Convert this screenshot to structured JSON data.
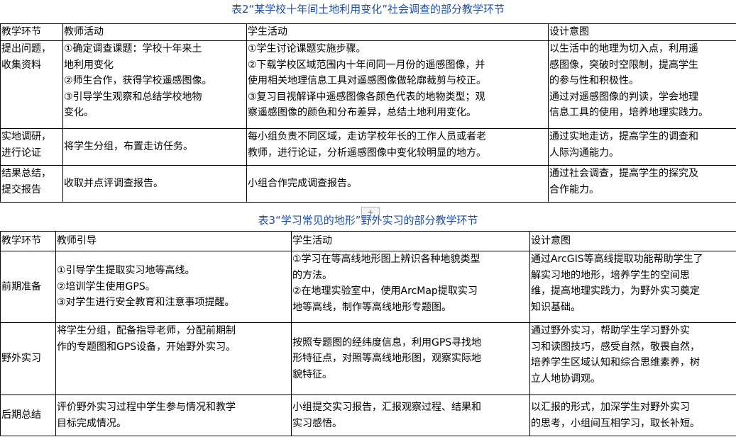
{
  "table2": {
    "caption": "表2“某学校十年间土地利用变化”社会调查的部分教学环节",
    "headers": [
      "教学环节",
      "教师活动",
      "学生活动",
      "设计意图"
    ],
    "rows": [
      [
        [
          "提出问题，",
          "收集资料"
        ],
        [
          "①确定调查课题：学校十年来土",
          "地利用变化",
          "②师生合作，获得学校遥感图像。",
          "③引导学生观察和总结学校地物",
          "变化。"
        ],
        [
          "①学生讨论课题实施步骤。",
          "②下载学校区域范围内十年间同一月份的遥感图像，并",
          "使用相关地理信息工具对遥感图像做轮廓裁剪与校正。",
          "③复习目视解译中遥感图像各颜色代表的地物类型；观",
          "察遥感图像的颜色和分布差异，总结土地利用变化。"
        ],
        [
          "以生活中的地理为切入点，利用遥",
          "感图像，突破时空限制，提高学生",
          "的参与性和积极性。",
          "通过对遥感图像的判读，学会地理",
          "信息工具的使用，培养地理实践力。"
        ]
      ],
      [
        [
          "实地调研，",
          "进行论证"
        ],
        [
          "将学生分组，布置走访任务。"
        ],
        [
          "每小组负责不同区域，走访学校年长的工作人员或者老",
          "教师，进行论证，分析遥感图像中变化较明显的地方。"
        ],
        [
          "通过实地走访，提高学生的调查和",
          "人际沟通能力。"
        ]
      ],
      [
        [
          "结果总结，",
          "提交报告"
        ],
        [
          "收取并点评调查报告。"
        ],
        [
          "小组合作完成调查报告。"
        ],
        [
          "通过社会调查，提高学生的探究及",
          "合作能力。"
        ]
      ]
    ]
  },
  "table3": {
    "caption": "表3“学习常见的地形”野外实习的部分教学环节",
    "headers": [
      "教学环节",
      "教师引导",
      "学生活动",
      "设计意图"
    ],
    "rows": [
      [
        [
          "前期准备"
        ],
        [
          "①引导学生提取实习地等高线。",
          "②培训学生使用GPS。",
          "③对学生进行安全教育和注意事项提醒。"
        ],
        [
          "①学习在等高线地形图上辨识各种地貌类型",
          "的方法。",
          "②在地理实验室中，使用ArcMap提取实习",
          "地等高线，制作等高线地形专题图。"
        ],
        [
          "通过ArcGIS等高线提取功能帮助学生了",
          "解实习地的地形，培养学生的空间思",
          "维，提高地理实践力，为野外实习奠定",
          "知识基础。"
        ]
      ],
      [
        [
          "野外实习"
        ],
        [
          "将学生分组，配备指导老师，分配前期制",
          "作的专题图和GPS设备，开始野外实习。"
        ],
        [
          "按照专题图的经纬度信息，利用GPS寻找地",
          "形特征点，对照等高线地形图，观察实际地",
          "貌特征。"
        ],
        [
          "通过野外实习，帮助学生学习野外实",
          "习和读图技巧，感受自然，敬畏自然，",
          "培养学生区域认知和综合思维素养，树",
          "立人地协调观。"
        ]
      ],
      [
        [
          "后期总结"
        ],
        [
          "评价野外实习过程中学生参与情况和教学",
          "目标完成情况。"
        ],
        [
          "小组提交实习报告，汇报观察过程、结果和",
          "实习感悟。"
        ],
        [
          "以汇报的形式，加深学生对野外实习",
          "的思考，小组间互相学习，取长补短。"
        ]
      ]
    ]
  },
  "editor": {
    "table_move_handle": "+"
  }
}
